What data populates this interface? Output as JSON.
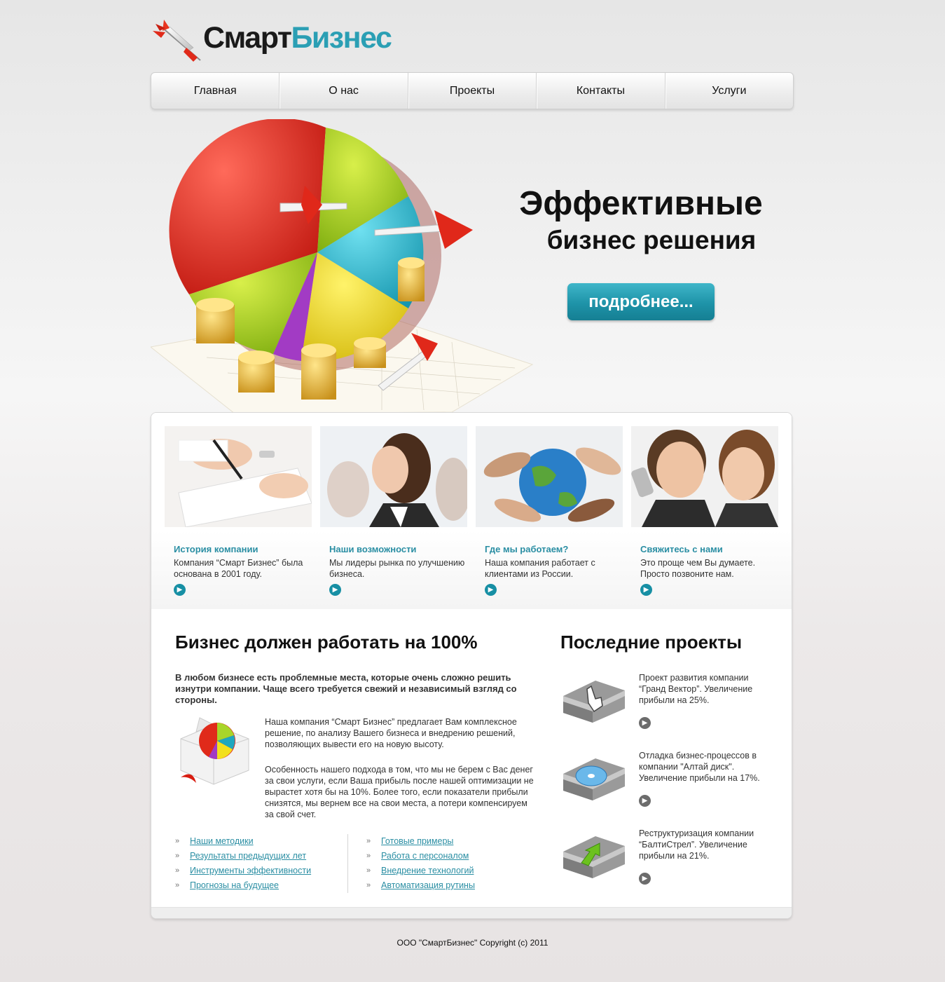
{
  "brand": {
    "part1": "Смарт",
    "part2": "Бизнес",
    "accent_color": "#2b9fb4"
  },
  "nav": [
    {
      "label": "Главная"
    },
    {
      "label": "О нас"
    },
    {
      "label": "Проекты"
    },
    {
      "label": "Контакты"
    },
    {
      "label": "Услуги"
    }
  ],
  "hero": {
    "title_line1": "Эффективные",
    "title_line2": "бизнес решения",
    "button": "подробнее...",
    "image_icon": "pie-chart-darts-coins-icon"
  },
  "features": [
    {
      "title": "История компании",
      "text": "Компания “Смарт Бизнес” была основана в 2001 году.",
      "icon": "signing-document-photo"
    },
    {
      "title": "Наши возможности",
      "text": "Мы лидеры рынка по улучшению бизнеса.",
      "icon": "businesswoman-photo"
    },
    {
      "title": "Где мы работаем?",
      "text": "Наша компания работает с клиентами из России.",
      "icon": "hands-globe-photo"
    },
    {
      "title": "Свяжитесь с нами",
      "text": "Это проще чем Вы думаете. Просто позвоните нам.",
      "icon": "people-phone-photo"
    }
  ],
  "main": {
    "heading": "Бизнес должен работать на 100%",
    "intro": "В любом бизнесе есть проблемные места, которые очень сложно решить изнутри компании. Чаще всего требуется свежий и независимый взгляд со стороны.",
    "para1": "Наша компания “Смарт Бизнес” предлагает Вам комплексное решение, по анализу Вашего бизнеса и внедрению решений, позволяющих вывести его на новую высоту.",
    "para2": "Особенность нашего подхода в том, что мы не берем с Вас денег за свои услуги, если Ваша прибыль после нашей оптимизации не вырастет хотя бы на 10%. Более того, если показатели прибыли снизятся, мы вернем все на свои места, а потери компенсируем за свой счет.",
    "links_left": [
      "Наши методики",
      "Результаты предыдущих лет",
      "Инструменты эффективности",
      "Прогнозы на будущее"
    ],
    "links_right": [
      "Готовые примеры",
      "Работа с персоналом",
      "Внедрение технологий",
      "Автоматизация рутины"
    ]
  },
  "projects": {
    "heading": "Последние проекты",
    "items": [
      {
        "text": "Проект развития компании “Гранд Вектор”. Увеличение прибыли на 25%.",
        "icon": "folder-hand-cursor-icon"
      },
      {
        "text": "Отладка бизнес-процессов в компании \"Алтай диск\". Увеличение прибыли на 17%.",
        "icon": "folder-disc-icon"
      },
      {
        "text": "Реструктуризация компании “БалтиСтрел”. Увеличение прибыли на 21%.",
        "icon": "folder-green-arrow-icon"
      }
    ]
  },
  "footer": {
    "copyright": "ООО \"СмартБизнес\" Copyright (c) 2011"
  }
}
